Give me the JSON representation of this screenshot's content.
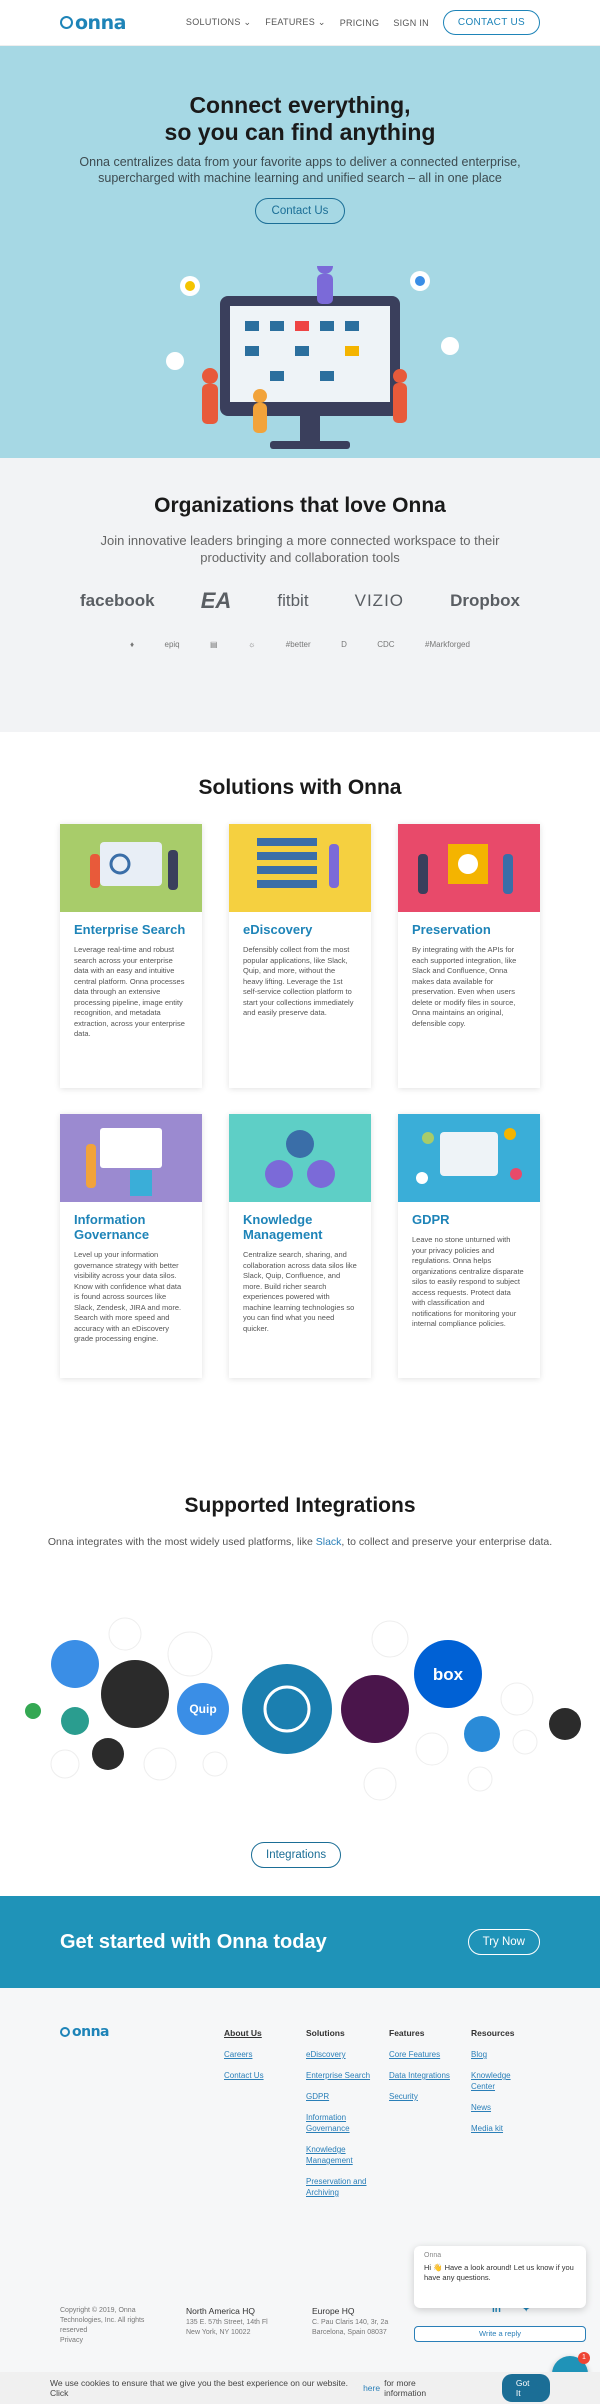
{
  "nav": {
    "logo": "onna",
    "items": [
      "SOLUTIONS",
      "FEATURES",
      "PRICING",
      "SIGN IN"
    ],
    "contact": "CONTACT US"
  },
  "hero": {
    "title_line1": "Connect everything,",
    "title_line2": "so you can find anything",
    "sub_line1": "Onna centralizes data from your favorite apps to deliver a connected enterprise,",
    "sub_line2": "supercharged with machine learning and unified search – all in one place",
    "cta": "Contact Us"
  },
  "orgs": {
    "title": "Organizations that love Onna",
    "subtitle": "Join innovative leaders bringing a more connected workspace to their productivity and collaboration tools",
    "logos": [
      "facebook",
      "EA",
      "fitbit",
      "VIZIO",
      "Dropbox"
    ],
    "small_logos": [
      "♦",
      "epiq",
      "▤",
      "☼",
      "#better",
      "D",
      "CDC",
      "#Markforged"
    ]
  },
  "solutions": {
    "title": "Solutions with Onna",
    "cards": [
      {
        "title": "Enterprise Search",
        "text": "Leverage real-time and robust search across your enterprise data with an easy and intuitive central platform. Onna processes data through an extensive processing pipeline, image entity recognition, and metadata extraction, across your enterprise data.",
        "color": "#a8cc6a"
      },
      {
        "title": "eDiscovery",
        "text": "Defensibly collect from the most popular applications, like Slack, Quip, and more, without the heavy lifting. Leverage the 1st self-service collection platform to start your collections immediately and easily preserve data.",
        "color": "#f5d040"
      },
      {
        "title": "Preservation",
        "text": "By integrating with the APIs for each supported integration, like Slack and Confluence, Onna makes data available for preservation. Even when users delete or modify files in source, Onna maintains an original, defensible copy.",
        "color": "#e84a6a"
      },
      {
        "title": "Information Governance",
        "text": "Level up your information governance strategy with better visibility across your data silos. Know with confidence what data is found across sources like Slack, Zendesk, JIRA and more. Search with more speed and accuracy with an eDiscovery grade processing engine.",
        "color": "#9b8ad0"
      },
      {
        "title": "Knowledge Management",
        "text": "Centralize search, sharing, and collaboration across data silos like Slack, Quip, Confluence, and more. Build richer search experiences powered with machine learning technologies so you can find what you need quicker.",
        "color": "#5ecfc6"
      },
      {
        "title": "GDPR",
        "text": "Leave no stone unturned with your privacy policies and regulations. Onna helps organizations centralize disparate silos to easily respond to subject access requests. Protect data with classification and notifications for monitoring your internal compliance policies.",
        "color": "#3aaed8"
      }
    ]
  },
  "integrations": {
    "title": "Supported Integrations",
    "text_before": "Onna integrates with the most widely used platforms, like ",
    "link": "Slack",
    "text_after": ", to collect and preserve your enterprise data.",
    "button": "Integrations",
    "labels": {
      "quip": "Quip",
      "box": "box"
    }
  },
  "banner": {
    "title": "Get started with Onna today",
    "button": "Try Now"
  },
  "footer": {
    "logo": "onna",
    "cols": [
      {
        "head": "About Us",
        "links": [
          "Careers",
          "Contact Us"
        ]
      },
      {
        "head": "Solutions",
        "links": [
          "eDiscovery",
          "Enterprise Search",
          "GDPR",
          "Information Governance",
          "Knowledge Management",
          "Preservation and Archiving"
        ]
      },
      {
        "head": "Features",
        "links": [
          "Core Features",
          "Data Integrations",
          "Security"
        ]
      },
      {
        "head": "Resources",
        "links": [
          "Blog",
          "Knowledge Center",
          "News",
          "Media kit"
        ]
      }
    ],
    "copyright": "Copyright © 2019, Onna Technologies, Inc. All rights reserved",
    "privacy": "Privacy",
    "hq_na_title": "North America HQ",
    "hq_na_address": "135 E. 57th Street, 14th Fl New York, NY 10022",
    "hq_eu_title": "Europe HQ",
    "hq_eu_address": "C. Pau Claris 140, 3r, 2a Barcelona, Spain 08037"
  },
  "chat": {
    "from": "Onna",
    "message": "Hi 👋 Have a look around! Let us know if you have any questions.",
    "reply": "Write a reply",
    "badge": "1"
  },
  "cookie": {
    "text_before": "We use cookies to ensure that we give you the best experience on our website. Click ",
    "link": "here",
    "text_after": " for more information",
    "button": "Got It"
  }
}
